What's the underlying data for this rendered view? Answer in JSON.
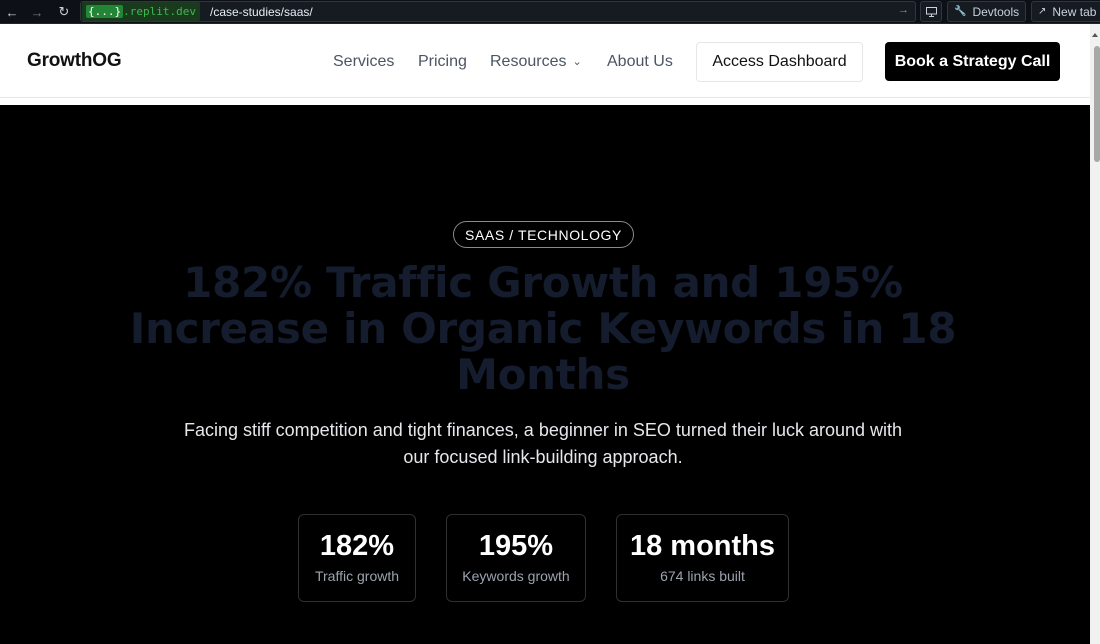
{
  "browser": {
    "domain_brace": "{...}",
    "domain_suffix": ".replit.dev",
    "path": "/case-studies/saas/",
    "devtools_label": "Devtools",
    "newtab_label": "New tab"
  },
  "header": {
    "brand": "GrowthOG",
    "nav": [
      "Services",
      "Pricing",
      "Resources",
      "About Us"
    ],
    "access_dashboard": "Access Dashboard",
    "book_call": "Book a Strategy Call"
  },
  "hero": {
    "badge": "SAAS / TECHNOLOGY",
    "headline": "182% Traffic Growth and 195% Increase in Organic Keywords in 18 Months",
    "subtext": "Facing stiff competition and tight finances, a beginner in SEO turned their luck around with our focused link-building approach.",
    "stats": [
      {
        "value": "182%",
        "label": "Traffic growth"
      },
      {
        "value": "195%",
        "label": "Keywords growth"
      },
      {
        "value": "18 months",
        "label": "674 links built"
      }
    ]
  },
  "colors": {
    "hero_bg": "#000000",
    "headline": "#141c2e",
    "accent_chip": "#3fb950"
  }
}
